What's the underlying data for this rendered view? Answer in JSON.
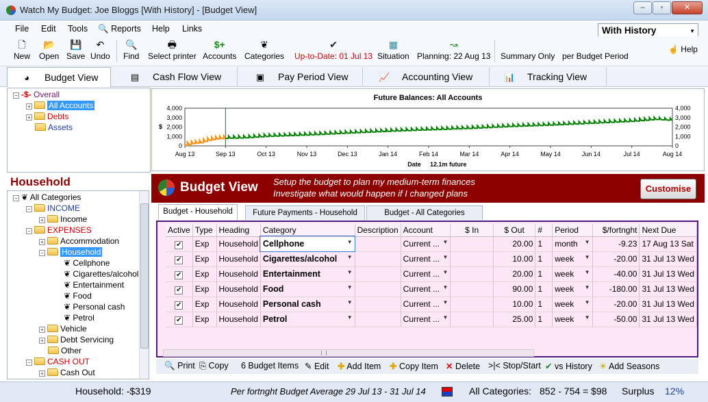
{
  "window": {
    "title": "Watch My Budget: Joe Bloggs [With History] - [Budget View]",
    "minimize": "–",
    "restore": "▫",
    "close": "✕"
  },
  "menu": [
    "File",
    "Edit",
    "Tools",
    "Reports",
    "Help",
    "Links"
  ],
  "history_mode": "With History",
  "toolbar": {
    "new": "New",
    "open": "Open",
    "save": "Save",
    "undo": "Undo",
    "find": "Find",
    "select_printer": "Select printer",
    "accounts": "Accounts",
    "categories": "Categories",
    "up_to_date": "Up-to-Date: 01 Jul 13",
    "situation": "Situation",
    "planning": "Planning: 22 Aug 13",
    "summary_only": "Summary Only",
    "per_budget_period": "per Budget Period",
    "help": "Help"
  },
  "view_tabs": [
    "Budget View",
    "Cash Flow View",
    "Pay Period View",
    "Accounting View",
    "Tracking View"
  ],
  "account_tree": {
    "overall": "Overall",
    "all_accounts": "All Accounts",
    "debts": "Debts",
    "assets": "Assets"
  },
  "chart_data": {
    "type": "line",
    "title": "Future Balances: All Accounts",
    "ylabel": "$",
    "xlabel": "Date",
    "x_note": "12.1m future",
    "ylim": [
      0,
      4000
    ],
    "y_ticks": [
      "4,000",
      "3,000",
      "2,000",
      "1,000",
      "0"
    ],
    "x_ticks": [
      "Aug 13",
      "Sep 13",
      "Oct 13",
      "Nov 13",
      "Dec 13",
      "Jan 14",
      "Feb 14",
      "Mar 14",
      "Apr 14",
      "May 14",
      "Jun 14",
      "Jul 14",
      "Aug 14"
    ],
    "series": [
      {
        "color": "#ff8c00",
        "x": [
          0,
          0.2,
          0.4,
          0.6,
          0.8,
          1.0
        ],
        "y": [
          50,
          250,
          350,
          600,
          750,
          800
        ]
      },
      {
        "color": "#008000",
        "x": [
          1.0,
          1.5,
          2,
          3,
          4,
          5,
          6,
          7,
          8,
          9,
          10,
          11,
          11.6,
          12
        ],
        "y": [
          800,
          850,
          1000,
          1150,
          1350,
          1550,
          1700,
          1850,
          2050,
          2200,
          2400,
          2600,
          2800,
          2700
        ]
      }
    ],
    "history_marker_x": 1.0
  },
  "household_title": "Household",
  "category_tree": {
    "all": "All Categories",
    "income": "INCOME",
    "income_child": "Income",
    "expenses": "EXPENSES",
    "accommodation": "Accommodation",
    "household": "Household",
    "children": [
      "Cellphone",
      "Cigarettes/alcohol",
      "Entertainment",
      "Food",
      "Personal cash",
      "Petrol"
    ],
    "vehicle": "Vehicle",
    "debt_servicing": "Debt Servicing",
    "other": "Other",
    "cash_out": "CASH OUT",
    "cash_out_child": "Cash Out"
  },
  "banner": {
    "title": "Budget View",
    "desc1": "Setup the budget to plan my medium-term finances",
    "desc2": "Investigate what would happen if I changed plans",
    "customise": "Customise"
  },
  "sub_tabs": [
    "Budget - Household",
    "Future Payments - Household",
    "Budget - All Categories"
  ],
  "grid": {
    "headers": [
      "Active",
      "Type",
      "Heading",
      "Category",
      "Description",
      "Account",
      "$ In",
      "$ Out",
      "#",
      "Period",
      "$/fortnght",
      "Next Due"
    ],
    "rows": [
      {
        "type": "Exp",
        "heading": "Household",
        "category": "Cellphone",
        "account": "Current ...",
        "out": "20.00",
        "n": "1",
        "period": "month",
        "fortnight": "-9.23",
        "next_due": "17 Aug 13 Sat"
      },
      {
        "type": "Exp",
        "heading": "Household",
        "category": "Cigarettes/alcohol",
        "account": "Current ...",
        "out": "10.00",
        "n": "1",
        "period": "week",
        "fortnight": "-20.00",
        "next_due": "31 Jul 13 Wed"
      },
      {
        "type": "Exp",
        "heading": "Household",
        "category": "Entertainment",
        "account": "Current ...",
        "out": "20.00",
        "n": "1",
        "period": "week",
        "fortnight": "-40.00",
        "next_due": "31 Jul 13 Wed"
      },
      {
        "type": "Exp",
        "heading": "Household",
        "category": "Food",
        "account": "Current ...",
        "out": "90.00",
        "n": "1",
        "period": "week",
        "fortnight": "-180.00",
        "next_due": "31 Jul 13 Wed"
      },
      {
        "type": "Exp",
        "heading": "Household",
        "category": "Personal cash",
        "account": "Current ...",
        "out": "10.00",
        "n": "1",
        "period": "week",
        "fortnight": "-20.00",
        "next_due": "31 Jul 13 Wed"
      },
      {
        "type": "Exp",
        "heading": "Household",
        "category": "Petrol",
        "account": "Current ...",
        "out": "25.00",
        "n": "1",
        "period": "week",
        "fortnight": "-50.00",
        "next_due": "31 Jul 13 Wed"
      }
    ]
  },
  "bottom_toolbar": {
    "print": "Print",
    "copy": "Copy",
    "count": "6 Budget Items",
    "edit": "Edit",
    "add_item": "Add Item",
    "copy_item": "Copy Item",
    "delete": "Delete",
    "stop_start": ">|< Stop/Start",
    "vs_history": "vs History",
    "add_seasons": "Add Seasons"
  },
  "status": {
    "household": "Household: -$319",
    "average": "Per fortnght Budget Average 29 Jul 13 - 31 Jul 14",
    "all_categories": "All Categories:",
    "totals": "852 - 754 = $98",
    "surplus": "Surplus",
    "surplus_pct": "12%"
  },
  "colors": {
    "banner": "#8c0000",
    "grid_bg": "#fde6f5",
    "grid_border": "#4c1a7d",
    "expense_text": "#cc0000",
    "link_blue": "#1f3f99"
  }
}
